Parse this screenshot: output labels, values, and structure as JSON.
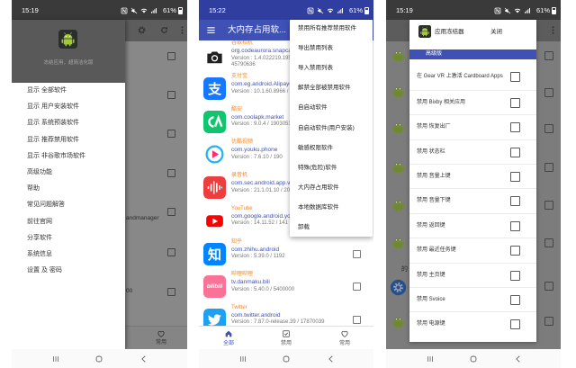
{
  "colors": {
    "primary": "#3f51b5",
    "primary_dark": "#303f9f",
    "app_name": "#f08c2c",
    "package_name": "#3f51b5",
    "version": "#757575",
    "scrim": "#7c7c7c"
  },
  "drawer_screen": {
    "status": {
      "time": "15:19",
      "battery": "61%"
    },
    "header_text": "冻结应用，超简洁化版",
    "menu": [
      "显示 全部软件",
      "显示 用户安装软件",
      "显示 系统预装软件",
      "显示 推荐禁用软件",
      "显示 非谷歌市场软件",
      "高级功能",
      "帮助",
      "常见问题解答",
      "前往官网",
      "分享软件",
      "系统信息",
      "设置 及 密码"
    ],
    "background": {
      "fragment_1": "andmanager",
      "fragment_2": "00",
      "nav_favorites": "常用"
    }
  },
  "list_screen": {
    "status": {
      "time": "15:22",
      "battery": "61%"
    },
    "title": "大内存占用软...",
    "apps": [
      {
        "name": "谷歌相机",
        "package": "org.codeaurora.snapcam",
        "version": "Version : 1.4.022219.195",
        "version_extra": "45790636",
        "icon": "camera-icon"
      },
      {
        "name": "支付宝",
        "package": "com.eg.android.AlipayGp",
        "version": "Version : 10.1.60.8966 / 1",
        "icon": "alipay-icon",
        "icon_text": "支",
        "icon_color": "#1677ff"
      },
      {
        "name": "酷安",
        "package": "com.coolapk.market",
        "version": "Version : 9.0.4 / 1903051",
        "icon": "coolapk-icon"
      },
      {
        "name": "优酷视频",
        "package": "com.youku.phone",
        "version": "Version : 7.6.10 / 190",
        "icon": "youku-icon"
      },
      {
        "name": "录音机",
        "package": "com.sec.android.app.voi",
        "version": "Version : 21.1.01.10 / 202",
        "icon": "voice-recorder-icon"
      },
      {
        "name": "YouTube",
        "package": "com.google.android.yout",
        "version": "Version : 14.11.52 / 141",
        "icon": "youtube-icon"
      },
      {
        "name": "知乎",
        "package": "com.zhihu.android",
        "version": "Version : 5.39.0 / 1192",
        "icon": "zhihu-icon",
        "icon_text": "知",
        "icon_color": "#0084ff"
      },
      {
        "name": "哔哩哔哩",
        "package": "tv.danmaku.bili",
        "version": "Version : 5.40.0 / 5400000",
        "icon": "bilibili-icon",
        "icon_text": "bilibili",
        "icon_color": "#fb7299"
      },
      {
        "name": "Twitter",
        "package": "com.twitter.android",
        "version": "Version : 7.87.0-release.39 / 17870039",
        "icon": "twitter-icon"
      }
    ],
    "overflow_menu": [
      "禁用所有推荐禁用软件",
      "导出禁用列表",
      "导入禁用列表",
      "解禁全部被禁用软件",
      "自启动软件",
      "自启动软件(用户安装)",
      "敏感权限软件",
      "特殊(危险)软件",
      "大内存占用软件",
      "本地数据库软件",
      "卸载"
    ],
    "bottom_nav": [
      {
        "label": "全部",
        "icon": "home-icon",
        "active": true
      },
      {
        "label": "禁用",
        "icon": "checkbox-icon",
        "active": false
      },
      {
        "label": "常用",
        "icon": "heart-icon",
        "active": false
      }
    ]
  },
  "dialog_screen": {
    "status": {
      "time": "15:19",
      "battery": "61%"
    },
    "dialog": {
      "title": "应用冻结器",
      "close_label": "关闭",
      "section": "高级版",
      "options": [
        "在 Gear VR 上激活 Cardboard Apps",
        "禁用 Bixby 相关应用",
        "禁用 恢复出厂",
        "禁用 状态栏",
        "禁用 音量上键",
        "禁用 音量下键",
        "禁用 返回键",
        "禁用 最近任务键",
        "禁用 主页键",
        "禁用 Svoice",
        "禁用 电源键"
      ]
    },
    "background": {
      "fragment": "的",
      "icons": [
        "android-icon",
        "android-icon",
        "android-icon",
        "android-icon",
        "android-icon",
        "android-icon",
        "settings-icon",
        "android-icon"
      ]
    }
  }
}
